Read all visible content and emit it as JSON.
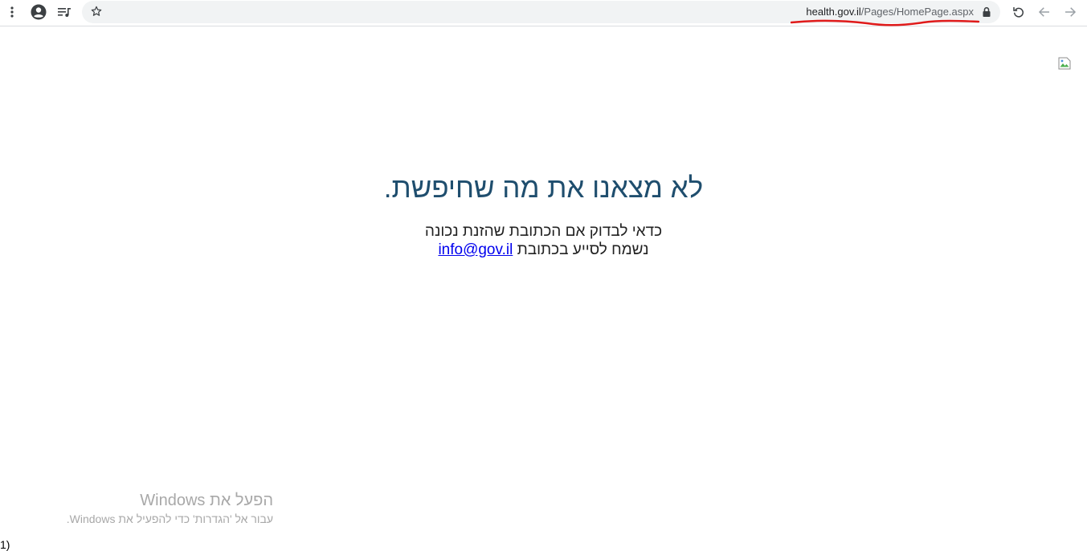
{
  "browser": {
    "url_domain": "health.gov.il",
    "url_path": "/Pages/HomePage.aspx",
    "icons": {
      "menu": "vertical-dots-icon",
      "profile": "account-circle-icon",
      "reading_list": "media-queue-icon",
      "bookmark": "star-icon",
      "lock": "lock-icon",
      "reload": "reload-icon",
      "back": "back-arrow-icon",
      "forward": "forward-arrow-icon"
    },
    "annotation_color": "#e01a1a"
  },
  "page": {
    "headline": "לא מצאנו את מה שחיפשת.",
    "line1": "כדאי לבדוק אם הכתובת שהזנת נכונה",
    "line2_prefix": "נשמח לסייע בכתובת",
    "email": "info@gov.il",
    "broken_image": "broken-image-icon",
    "headline_color": "#1f4e6e"
  },
  "watermark": {
    "title": "הפעל את Windows",
    "subtitle": "עבור אל 'הגדרות' כדי להפעיל את Windows."
  },
  "corner_text": "1)"
}
